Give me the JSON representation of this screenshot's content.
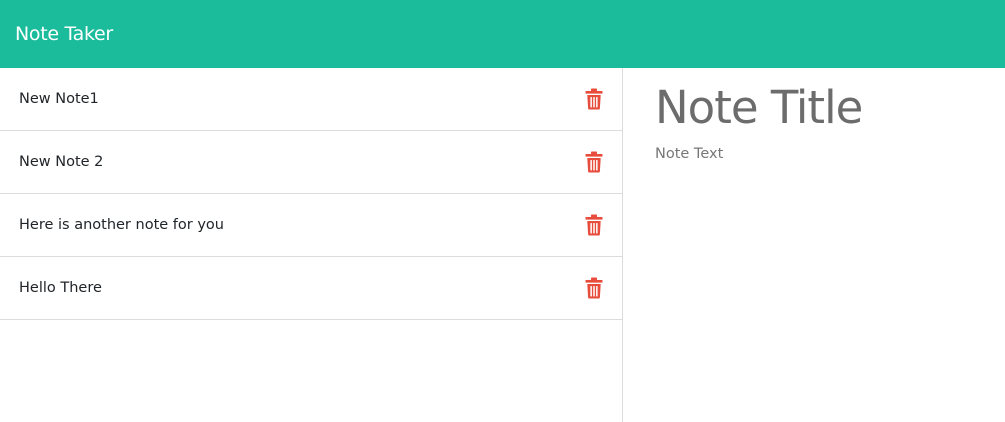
{
  "app": {
    "brand": "Note Taker"
  },
  "notes": [
    {
      "title": "New Note1",
      "icon": "trash-icon"
    },
    {
      "title": "New Note 2",
      "icon": "trash-icon"
    },
    {
      "title": "Here is another note for you",
      "icon": "trash-icon"
    },
    {
      "title": "Hello There",
      "icon": "trash-icon"
    }
  ],
  "editor": {
    "title_placeholder": "Note Title",
    "text_placeholder": "Note Text"
  },
  "colors": {
    "navbar": "#1abc9c",
    "delete_icon": "#e74c3c"
  }
}
